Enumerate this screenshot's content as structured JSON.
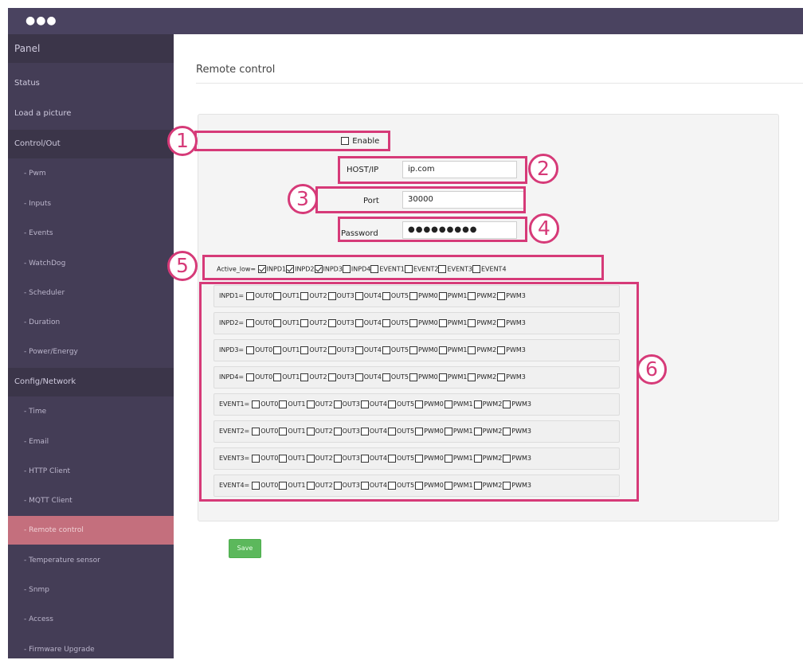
{
  "window": {
    "dots": "●●●"
  },
  "sidebar": {
    "items": [
      {
        "label": "Panel",
        "kind": "panel"
      },
      {
        "label": "Status",
        "kind": "top"
      },
      {
        "label": "Load a picture",
        "kind": "top"
      },
      {
        "label": "Control/Out",
        "kind": "group"
      },
      {
        "label": "- Pwm",
        "kind": "sub"
      },
      {
        "label": "- Inputs",
        "kind": "sub"
      },
      {
        "label": "- Events",
        "kind": "sub"
      },
      {
        "label": "- WatchDog",
        "kind": "sub"
      },
      {
        "label": "- Scheduler",
        "kind": "sub"
      },
      {
        "label": "- Duration",
        "kind": "sub"
      },
      {
        "label": "- Power/Energy",
        "kind": "sub"
      },
      {
        "label": "Config/Network",
        "kind": "group"
      },
      {
        "label": "- Time",
        "kind": "sub"
      },
      {
        "label": "- Email",
        "kind": "sub"
      },
      {
        "label": "- HTTP Client",
        "kind": "sub"
      },
      {
        "label": "- MQTT Client",
        "kind": "sub"
      },
      {
        "label": "- Remote control",
        "kind": "sub",
        "active": true
      },
      {
        "label": "- Temperature sensor",
        "kind": "sub"
      },
      {
        "label": "- Snmp",
        "kind": "sub"
      },
      {
        "label": "- Access",
        "kind": "sub"
      },
      {
        "label": "- Firmware Upgrade",
        "kind": "sub"
      }
    ]
  },
  "main": {
    "title": "Remote control",
    "enable": {
      "label": "Enable",
      "checked": false
    },
    "host": {
      "label": "HOST/IP",
      "value": "ip.com"
    },
    "port": {
      "label": "Port",
      "value": "30000"
    },
    "password": {
      "label": "Password",
      "value": "●●●●●●●●●"
    },
    "active_low": {
      "label": "Active_low=",
      "items": [
        {
          "label": "INPD1",
          "checked": true
        },
        {
          "label": "INPD2",
          "checked": true
        },
        {
          "label": "INPD3",
          "checked": true
        },
        {
          "label": "INPD4",
          "checked": false
        },
        {
          "label": "EVENT1",
          "checked": false
        },
        {
          "label": "EVENT2",
          "checked": false
        },
        {
          "label": "EVENT3",
          "checked": false
        },
        {
          "label": "EVENT4",
          "checked": false
        }
      ]
    },
    "outputs": [
      "OUT0",
      "OUT1",
      "OUT2",
      "OUT3",
      "OUT4",
      "OUT5",
      "PWM0",
      "PWM1",
      "PWM2",
      "PWM3"
    ],
    "mappings": [
      {
        "label": "INPD1="
      },
      {
        "label": "INPD2="
      },
      {
        "label": "INPD3="
      },
      {
        "label": "INPD4="
      },
      {
        "label": "EVENT1="
      },
      {
        "label": "EVENT2="
      },
      {
        "label": "EVENT3="
      },
      {
        "label": "EVENT4="
      }
    ],
    "save_label": "Save"
  },
  "callouts": [
    "1",
    "2",
    "3",
    "4",
    "5",
    "6"
  ],
  "colors": {
    "accent": "#d63a78",
    "sidebar": "#443d56",
    "active": "#c46f7d",
    "save": "#5cb85c"
  }
}
